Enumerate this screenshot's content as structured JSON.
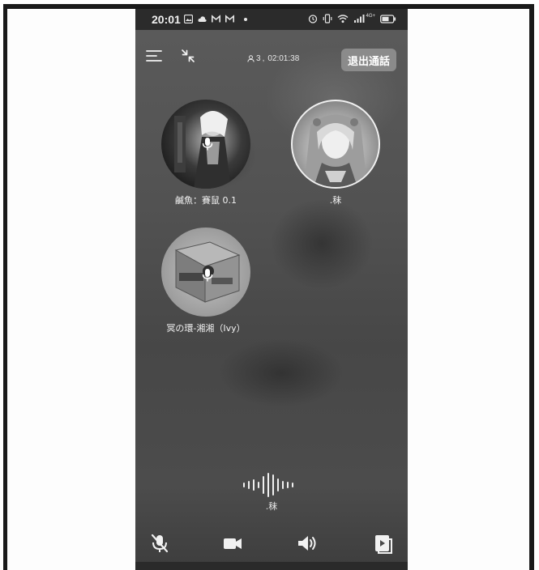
{
  "status_bar": {
    "time": "20:01",
    "network": "4G+"
  },
  "top_bar": {
    "participant_count": "3",
    "call_duration": "02:01:38",
    "exit_button_label": "退出通話"
  },
  "participants": [
    {
      "name": "鹹魚：賽鼠 0.1",
      "icon": "avatar-anime-character"
    },
    {
      "name": ".秣",
      "icon": "avatar-cosplay-portrait"
    },
    {
      "name": "冥の環-湘湘（Ivy）",
      "icon": "avatar-game-screenshot"
    }
  ],
  "active_speaker": {
    "name": ".秣"
  },
  "controls": [
    {
      "icon": "mic-muted-icon"
    },
    {
      "icon": "camera-icon"
    },
    {
      "icon": "speaker-icon"
    },
    {
      "icon": "screen-share-icon"
    }
  ],
  "colors": {
    "background": "#4f4f4f",
    "exit_button": "#8b8b8b",
    "text": "#f3f3f3"
  }
}
